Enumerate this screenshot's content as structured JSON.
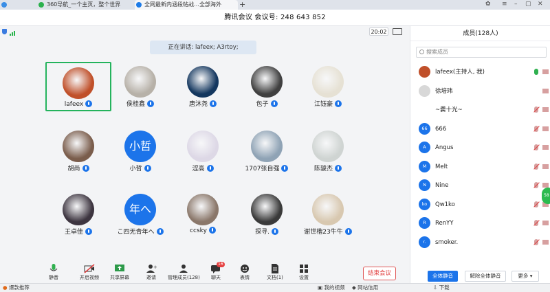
{
  "browser": {
    "tabs": [
      {
        "label": "",
        "color": "#3a8ee6"
      },
      {
        "label": "360导航_一个主页，整个世界",
        "color": "#2cb14e"
      },
      {
        "label": "全网最新内涵段帖战…全部海外",
        "color": "#1e7ce8"
      }
    ],
    "plus": "+",
    "window_icons": [
      "shirt-icon",
      "menu-icon",
      "minimize-icon",
      "maximize-icon",
      "close-icon"
    ]
  },
  "meeting": {
    "title": "腾讯会议 会议号: 248 643 852",
    "timer": "20:02",
    "speaking_banner": "正在讲话: lafeex; A3rtoy;",
    "participants": [
      {
        "name": "lafeex",
        "selected": true,
        "avatar_color": "#c0502a"
      },
      {
        "name": "侯桂鑫",
        "avatar_color": "#b7b1a8"
      },
      {
        "name": "唐沐尧",
        "avatar_color": "#14375f"
      },
      {
        "name": "包子",
        "avatar_color": "#404040"
      },
      {
        "name": "江钰豪",
        "avatar_color": "#e6e1d4"
      },
      {
        "name": "胡尚",
        "avatar_color": "#7a5d4c"
      },
      {
        "name": "小哲",
        "avatar_text": "小哲"
      },
      {
        "name": "涩高",
        "avatar_color": "#ddd8e6"
      },
      {
        "name": "1707张自强",
        "avatar_color": "#8fa3b5"
      },
      {
        "name": "陈骏杰",
        "avatar_color": "#cfd4d2"
      },
      {
        "name": "王卓佳",
        "avatar_color": "#3d3540"
      },
      {
        "name": "こ四无青年へ",
        "avatar_text": "年へ"
      },
      {
        "name": "ccsky",
        "avatar_color": "#8a776a"
      },
      {
        "name": "探寻.",
        "avatar_color": "#3a3a3a"
      },
      {
        "name": "谢世楷23牛牛",
        "avatar_color": "#d8c8b0"
      }
    ],
    "toolbar": [
      {
        "label": "静音",
        "icon": "microphone-icon"
      },
      {
        "label": "开启视频",
        "icon": "camera-off-icon"
      },
      {
        "label": "共享屏幕",
        "icon": "share-screen-icon"
      },
      {
        "label": "邀请",
        "icon": "add-user-icon"
      },
      {
        "label": "管理成员(128)",
        "icon": "members-icon"
      },
      {
        "label": "聊天",
        "icon": "chat-icon",
        "badge": "16"
      },
      {
        "label": "表情",
        "icon": "emoji-icon"
      },
      {
        "label": "文档(1)",
        "icon": "document-icon"
      },
      {
        "label": "设置",
        "icon": "settings-icon"
      }
    ],
    "end_button": "结束会议"
  },
  "panel": {
    "title": "成员(128人)",
    "search_placeholder": "搜索成员",
    "members": [
      {
        "name": "lafeex(主持人, 我)",
        "avatar": "",
        "mic": "on"
      },
      {
        "name": "徐培玮",
        "avatar": "",
        "mic": "none"
      },
      {
        "name": "~爨十光~",
        "avatar": "",
        "mic": "off"
      },
      {
        "name": "666",
        "avatar": "66",
        "mic": "off"
      },
      {
        "name": "Angus",
        "avatar": "A",
        "mic": "off"
      },
      {
        "name": "Melt",
        "avatar": "M",
        "mic": "off"
      },
      {
        "name": "Nine",
        "avatar": "N",
        "mic": "off"
      },
      {
        "name": "Qw1ko",
        "avatar": "ko",
        "mic": "off"
      },
      {
        "name": "RenYY",
        "avatar": "R",
        "mic": "off"
      },
      {
        "name": "smoker.",
        "avatar": "r.",
        "mic": "off"
      }
    ],
    "buttons": {
      "mute_all": "全体静音",
      "unmute_all": "解除全体静音",
      "more": "更多 ▾"
    },
    "float_badge": "58"
  },
  "statusbar": {
    "left": "爆款推荐",
    "items": [
      "我的视频",
      "网站信用",
      "下载"
    ]
  },
  "colors": {
    "accent": "#1c74ea",
    "selected_border": "#24b35d",
    "end_red": "#e03b3b"
  }
}
